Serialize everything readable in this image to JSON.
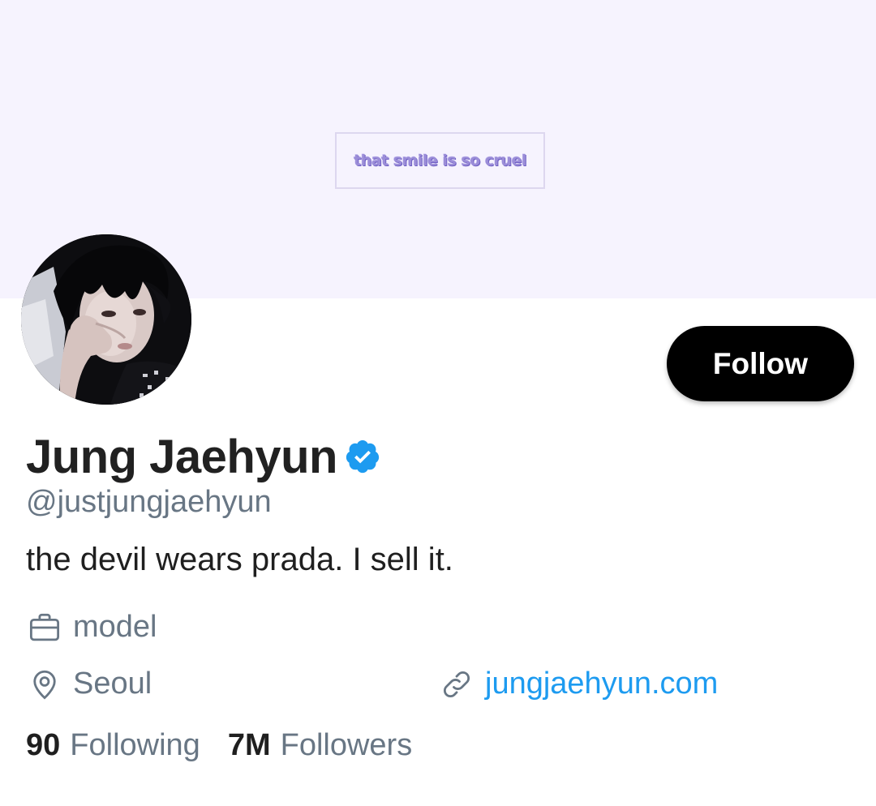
{
  "banner": {
    "text": "that smile is so cruel",
    "background_color": "#f6f3fe"
  },
  "profile": {
    "display_name": "Jung Jaehyun",
    "verified": true,
    "handle": "@justjungjaehyun",
    "bio": "the devil wears prada. I sell it.",
    "avatar_icon": "avatar-photo"
  },
  "actions": {
    "follow_label": "Follow"
  },
  "meta": {
    "work": {
      "icon": "briefcase-icon",
      "text": "model"
    },
    "location": {
      "icon": "location-pin-icon",
      "text": "Seoul"
    },
    "website": {
      "icon": "link-icon",
      "text": "jungjaehyun.com"
    }
  },
  "stats": {
    "following_count": "90",
    "following_label": "Following",
    "followers_count": "7M",
    "followers_label": "Followers"
  },
  "colors": {
    "accent": "#1d9bf0",
    "secondary_text": "#687684",
    "primary_text": "#1f1f1f",
    "button_bg": "#000000"
  }
}
